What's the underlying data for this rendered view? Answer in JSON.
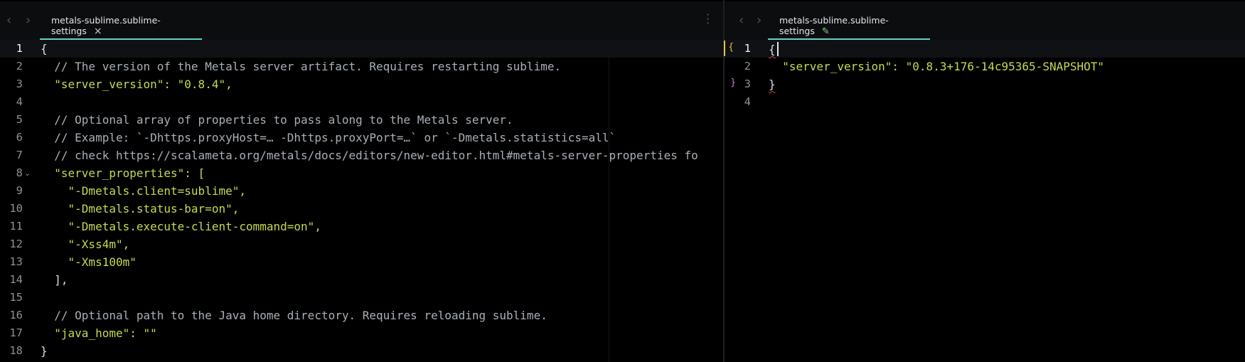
{
  "app": {
    "nav_back": "‹",
    "nav_forward": "›",
    "pane_menu": "⋮"
  },
  "left_pane": {
    "tab": {
      "title": "metals-sublime.sublime-settings",
      "close_glyph": "×",
      "active": true
    },
    "lines": [
      {
        "n": "1",
        "code": "{"
      },
      {
        "n": "2",
        "code": "  // The version of the Metals server artifact. Requires restarting sublime."
      },
      {
        "n": "3",
        "code": "  \"server_version\": \"0.8.4\","
      },
      {
        "n": "4",
        "code": ""
      },
      {
        "n": "5",
        "code": "  // Optional array of properties to pass along to the Metals server."
      },
      {
        "n": "6",
        "code": "  // Example: `-Dhttps.proxyHost=… -Dhttps.proxyPort=…` or `-Dmetals.statistics=all`"
      },
      {
        "n": "7",
        "code": "  // check https://scalameta.org/metals/docs/editors/new-editor.html#metals-server-properties fo"
      },
      {
        "n": "8",
        "code": "  \"server_properties\": ["
      },
      {
        "n": "9",
        "code": "    \"-Dmetals.client=sublime\","
      },
      {
        "n": "10",
        "code": "    \"-Dmetals.status-bar=on\","
      },
      {
        "n": "11",
        "code": "    \"-Dmetals.execute-client-command=on\","
      },
      {
        "n": "12",
        "code": "    \"-Xss4m\","
      },
      {
        "n": "13",
        "code": "    \"-Xms100m\""
      },
      {
        "n": "14",
        "code": "  ],"
      },
      {
        "n": "15",
        "code": ""
      },
      {
        "n": "16",
        "code": "  // Optional path to the Java home directory. Requires reloading sublime."
      },
      {
        "n": "17",
        "code": "  \"java_home\": \"\""
      },
      {
        "n": "18",
        "code": "}"
      }
    ],
    "active_line": "1",
    "fold_marker": "⌄"
  },
  "right_pane": {
    "tab": {
      "title": "metals-sublime.sublime-settings",
      "dirty_glyph": "✎",
      "active": true
    },
    "lines": [
      {
        "n": "1",
        "code": "{"
      },
      {
        "n": "2",
        "code": "  \"server_version\": \"0.8.3+176-14c95365-SNAPSHOT\""
      },
      {
        "n": "3",
        "code": "}"
      },
      {
        "n": "4",
        "code": ""
      }
    ],
    "active_line": "1",
    "bracket_open_marker": "{",
    "bracket_close_marker": "}"
  },
  "colors": {
    "background": "#000000",
    "tab_underline": "#5fd3c4",
    "string": "#c9d84f",
    "comment": "#a9afb7",
    "squiggle": "#e03c3c",
    "modified_marker": "#e5c24b"
  }
}
